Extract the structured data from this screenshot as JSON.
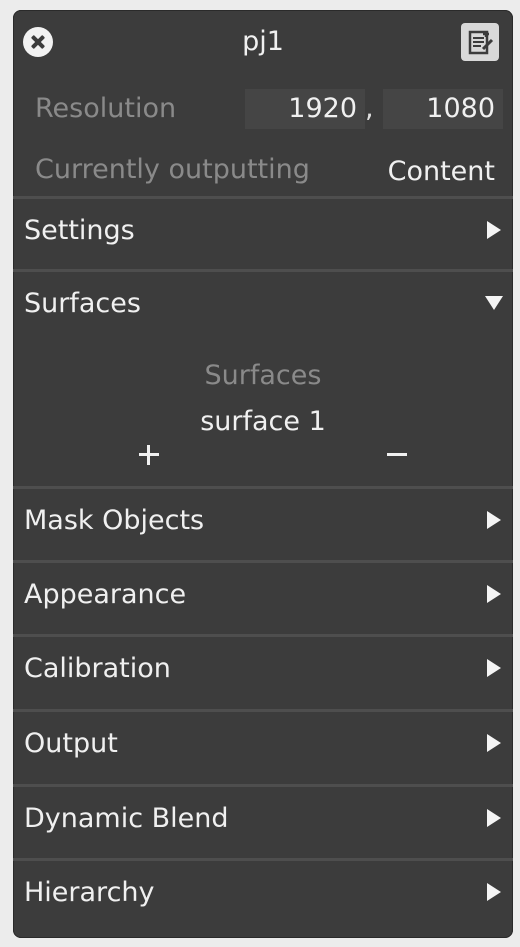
{
  "window": {
    "title": "pj1"
  },
  "icons": {
    "close": "close-circle-icon",
    "notes": "edit-note-icon"
  },
  "resolution": {
    "label": "Resolution",
    "width": "1920",
    "separator": ",",
    "height": "1080"
  },
  "output_status": {
    "label": "Currently outputting",
    "value": "Content"
  },
  "sections": {
    "settings": {
      "label": "Settings",
      "expanded": false
    },
    "surfaces": {
      "label": "Surfaces",
      "expanded": true,
      "list_header": "Surfaces",
      "items": [
        "surface 1"
      ]
    },
    "mask_objects": {
      "label": "Mask Objects",
      "expanded": false
    },
    "appearance": {
      "label": "Appearance",
      "expanded": false
    },
    "calibration": {
      "label": "Calibration",
      "expanded": false
    },
    "output": {
      "label": "Output",
      "expanded": false
    },
    "dynamic_blend": {
      "label": "Dynamic Blend",
      "expanded": false
    },
    "hierarchy": {
      "label": "Hierarchy",
      "expanded": false
    }
  },
  "colors": {
    "panel_bg": "#3c3c3c",
    "text": "#f0f0f0",
    "muted_text": "#8a8a8a",
    "field_bg": "#454545"
  }
}
